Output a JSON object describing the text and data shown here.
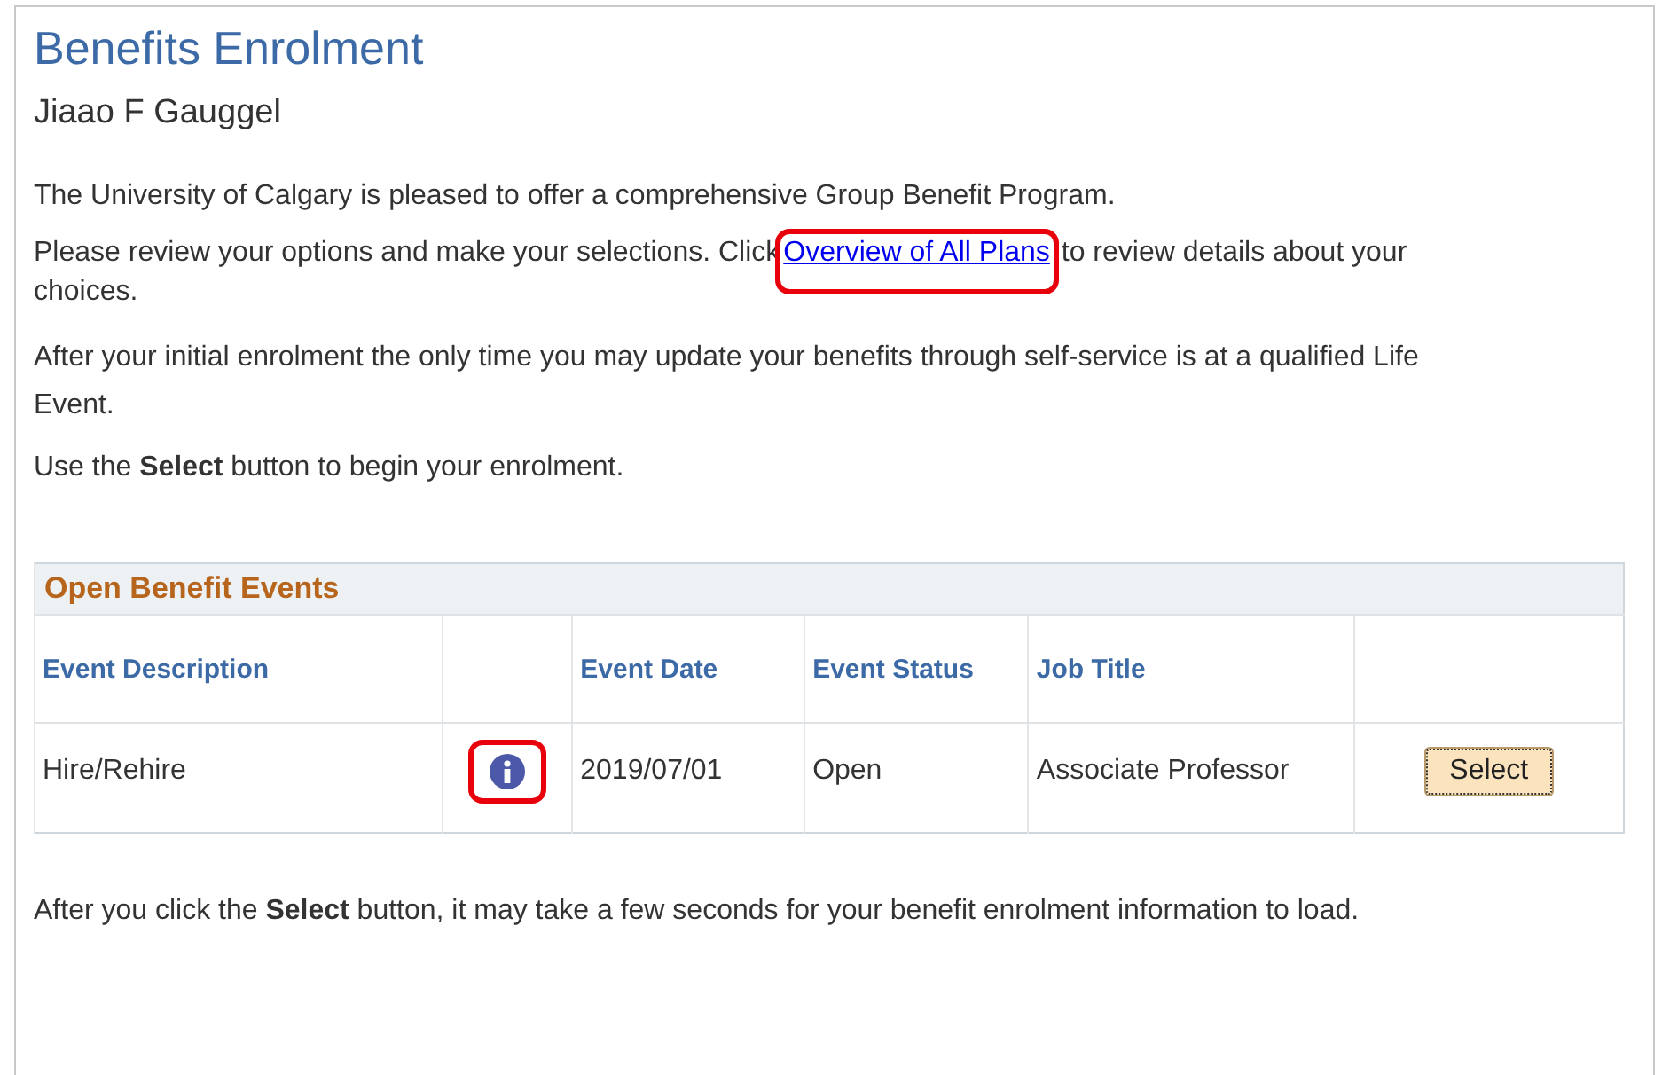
{
  "title": "Benefits Enrolment",
  "employee_name": "Jiaao F Gauggel",
  "paragraphs": [
    {
      "kind": "text",
      "text": "The University of Calgary is pleased to offer a comprehensive Group Benefit Program."
    },
    {
      "kind": "link",
      "before": "Please review your options and make your selections. Click",
      "link": {
        "text": "Overview of All Plans",
        "highlighted": true
      },
      "after": " to review details about your choices."
    },
    {
      "kind": "text",
      "text": "After your initial enrolment the only time you may update your benefits through self-service is at a qualified Life Event."
    },
    {
      "kind": "text",
      "text": "Use the **Select** button to begin your enrolment."
    }
  ],
  "events_table": {
    "title": "Open Benefit Events",
    "columns": [
      "Event Description",
      "",
      "Event Date",
      "Event Status",
      "Job Title",
      ""
    ],
    "rows": [
      {
        "description": "Hire/Rehire",
        "info_highlighted": true,
        "date": "2019/07/01",
        "status": "Open",
        "job_title": "Associate Professor",
        "button": "Select"
      }
    ]
  },
  "footer_note": "After you click the **Select** button, it may take a few seconds for your benefit enrolment information to load."
}
